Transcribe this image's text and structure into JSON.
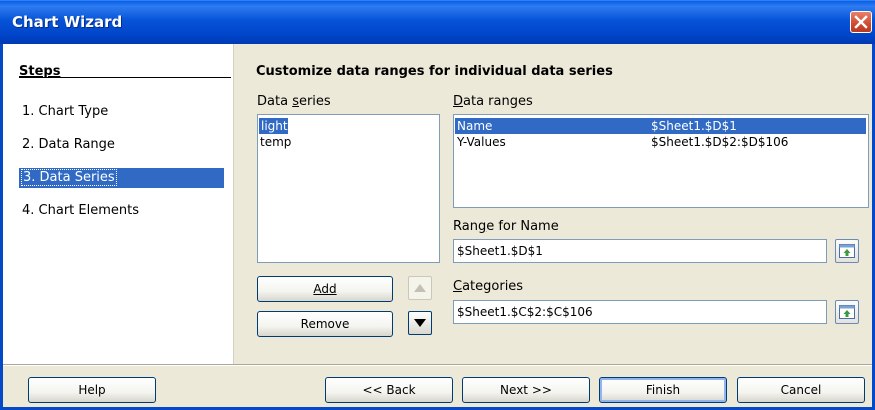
{
  "window": {
    "title": "Chart Wizard"
  },
  "steps": {
    "title": "Steps",
    "items": [
      {
        "label": "1. Chart Type"
      },
      {
        "label": "2. Data Range"
      },
      {
        "label": "3. Data Series"
      },
      {
        "label": "4. Chart Elements"
      }
    ],
    "selected_index": 2
  },
  "main": {
    "heading": "Customize data ranges for individual data series",
    "data_series_label": "Data series",
    "data_series_items": [
      "light",
      "temp"
    ],
    "data_ranges_label": "Data ranges",
    "data_ranges_rows": [
      {
        "name": "Name",
        "range": "$Sheet1.$D$1"
      },
      {
        "name": "Y-Values",
        "range": "$Sheet1.$D$2:$D$106"
      }
    ],
    "range_for_name_label": "Range for Name",
    "range_for_name_value": "$Sheet1.$D$1",
    "categories_label": "Categories",
    "categories_value": "$Sheet1.$C$2:$C$106",
    "add_label": "Add",
    "remove_label": "Remove"
  },
  "buttons": {
    "help": "Help",
    "back": "<< Back",
    "next": "Next >>",
    "finish": "Finish",
    "cancel": "Cancel"
  },
  "icons": {
    "close": "close-icon",
    "move_up": "arrow-up-icon",
    "move_down": "arrow-down-icon",
    "shrink_range": "select-range-icon"
  }
}
